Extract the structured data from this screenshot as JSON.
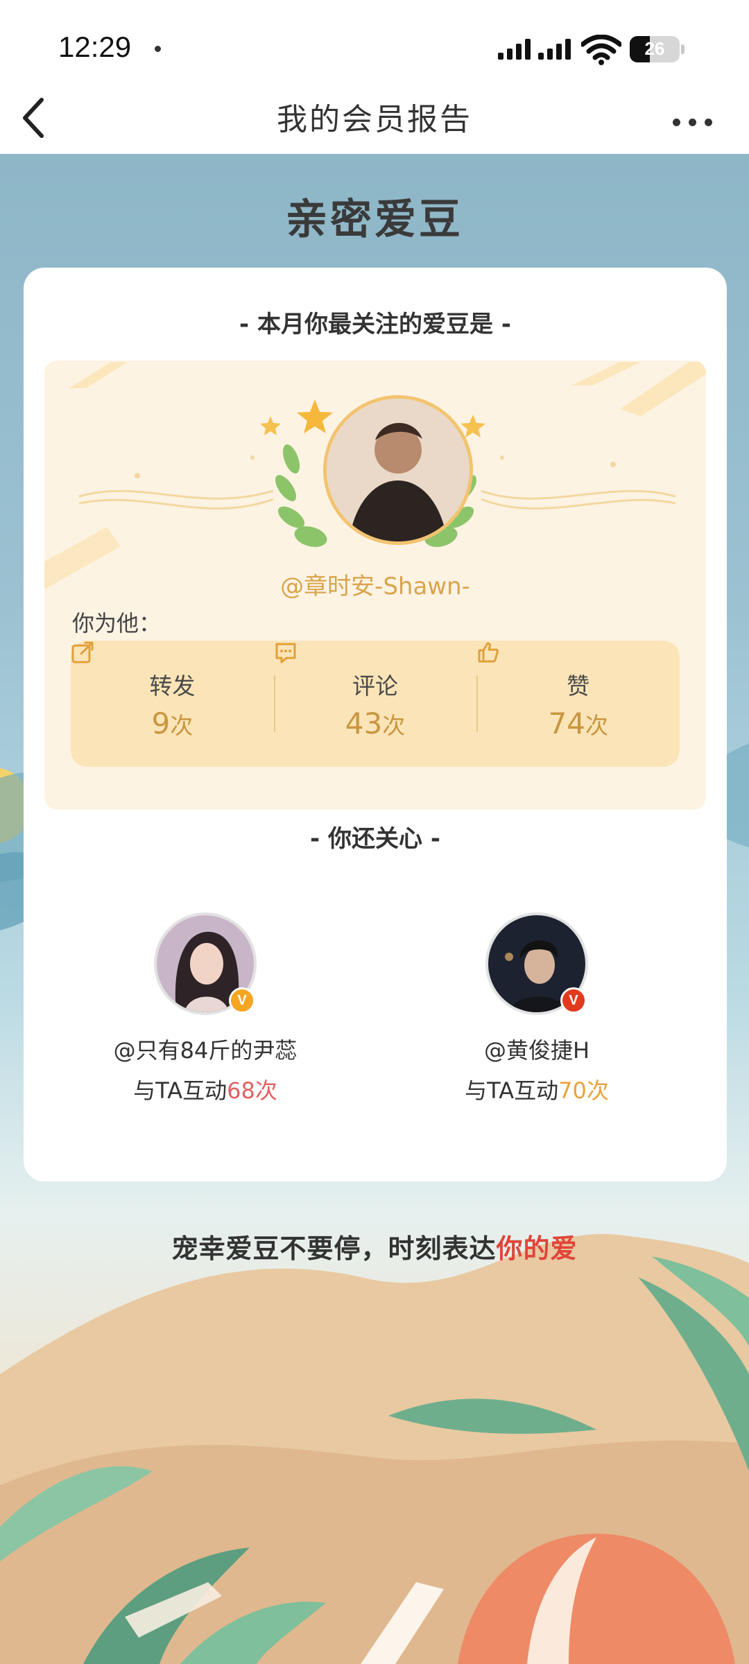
{
  "status_bar": {
    "time": "12:29",
    "battery": "26"
  },
  "nav": {
    "title": "我的会员报告"
  },
  "section": {
    "title": "亲密爱豆"
  },
  "card": {
    "heading": "- 本月你最关注的爱豆是 -",
    "main_idol": {
      "handle": "@章时安-Shawn-"
    },
    "you_for_label": "你为他：",
    "stats": [
      {
        "icon": "share-icon",
        "label": "转发",
        "value": "9",
        "unit": "次"
      },
      {
        "icon": "comment-icon",
        "label": "评论",
        "value": "43",
        "unit": "次"
      },
      {
        "icon": "thumbs-up-icon",
        "label": "赞",
        "value": "74",
        "unit": "次"
      }
    ],
    "also_heading": "- 你还关心 -",
    "also": [
      {
        "handle": "@只有84斤的尹蕊",
        "interact_prefix": "与TA互动",
        "count": "68次",
        "count_color": "#e06060",
        "badge_color": "#f5a623"
      },
      {
        "handle": "@黄俊捷H",
        "interact_prefix": "与TA互动",
        "count": "70次",
        "count_color": "#e9a23b",
        "badge_color": "#e23a1e"
      }
    ]
  },
  "slogan": {
    "text": "宠幸爱豆不要停，时刻表达",
    "highlight": "你的爱"
  },
  "colors": {
    "accent_gold": "#d9a44b",
    "highlight_red": "#e0453a",
    "panel_bg": "#fdf3e3",
    "stats_bg": "#fbe5b8"
  }
}
